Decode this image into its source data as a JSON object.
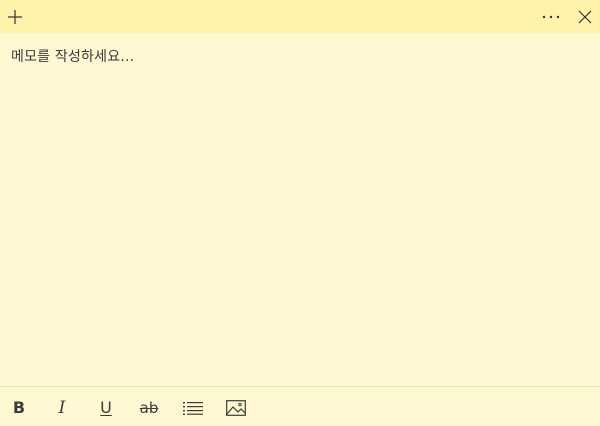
{
  "titlebar": {
    "add_icon": "plus-icon",
    "more_icon": "more-icon",
    "close_icon": "close-icon"
  },
  "editor": {
    "placeholder": "메모를 작성하세요..."
  },
  "toolbar": {
    "bold_label": "B",
    "italic_label": "I",
    "underline_label": "U",
    "strikethrough_label": "ab",
    "list_icon": "bulleted-list-icon",
    "image_icon": "image-icon"
  },
  "colors": {
    "background": "#fff7d1",
    "titlebar": "#fff2ab",
    "text": "#3a3a3a"
  }
}
